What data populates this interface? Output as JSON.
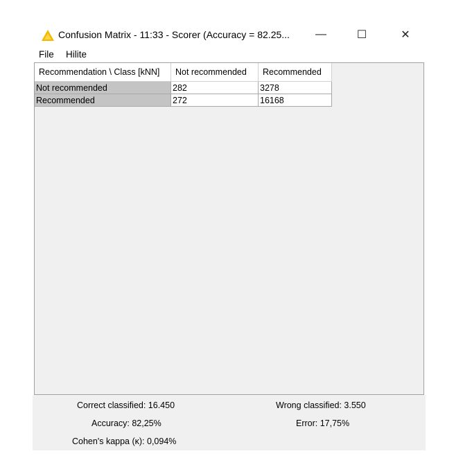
{
  "window": {
    "title": "Confusion Matrix - 11:33 - Scorer (Accuracy = 82.25...",
    "icon": "warning-triangle-icon",
    "icon_color": "#f5b800",
    "minimize_glyph": "—",
    "maximize_glyph": "☐",
    "close_glyph": "✕"
  },
  "menu": {
    "file": "File",
    "hilite": "Hilite"
  },
  "table": {
    "headers": [
      "Recommendation \\ Class [kNN]",
      "Not recommended",
      "Recommended"
    ],
    "rows": [
      {
        "label": "Not recommended",
        "values": [
          "282",
          "3278"
        ]
      },
      {
        "label": "Recommended",
        "values": [
          "272",
          "16168"
        ]
      }
    ]
  },
  "stats": {
    "correct": "Correct classified: 16.450",
    "wrong": "Wrong classified: 3.550",
    "accuracy": "Accuracy: 82,25%",
    "error": "Error: 17,75%",
    "kappa": "Cohen's kappa (κ): 0,094%"
  }
}
